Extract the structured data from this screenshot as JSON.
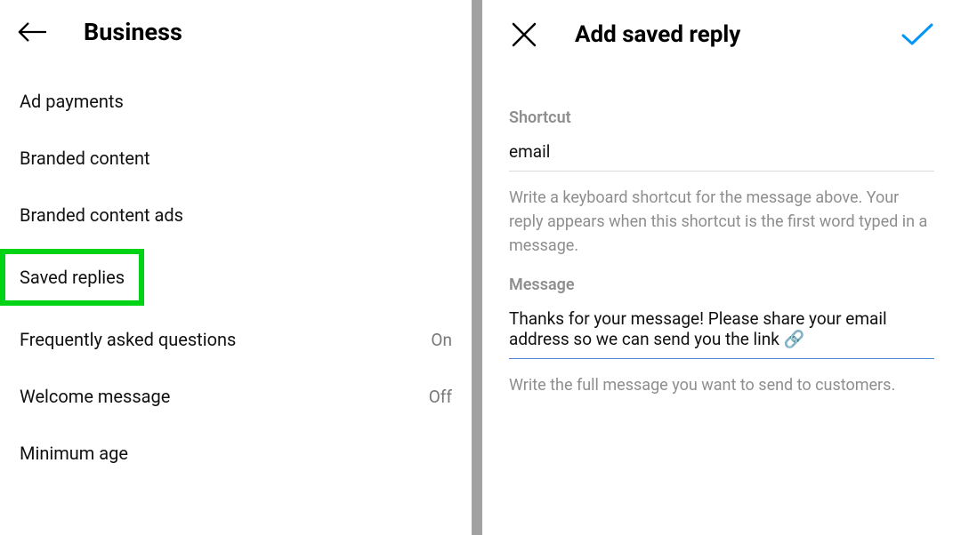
{
  "left": {
    "title": "Business",
    "items": [
      {
        "label": "Ad payments",
        "status": ""
      },
      {
        "label": "Branded content",
        "status": ""
      },
      {
        "label": "Branded content ads",
        "status": ""
      },
      {
        "label": "Saved replies",
        "status": "",
        "highlighted": true
      },
      {
        "label": "Frequently asked questions",
        "status": "On"
      },
      {
        "label": "Welcome message",
        "status": "Off"
      },
      {
        "label": "Minimum age",
        "status": ""
      }
    ]
  },
  "right": {
    "title": "Add saved reply",
    "shortcut": {
      "label": "Shortcut",
      "value": "email",
      "helper": "Write a keyboard shortcut for the message above. Your reply appears when this shortcut is the first word typed in a message."
    },
    "message": {
      "label": "Message",
      "value": "Thanks for your message! Please share your email address so we can send you the link 🔗",
      "helper": "Write the full message you want to send to customers."
    }
  }
}
